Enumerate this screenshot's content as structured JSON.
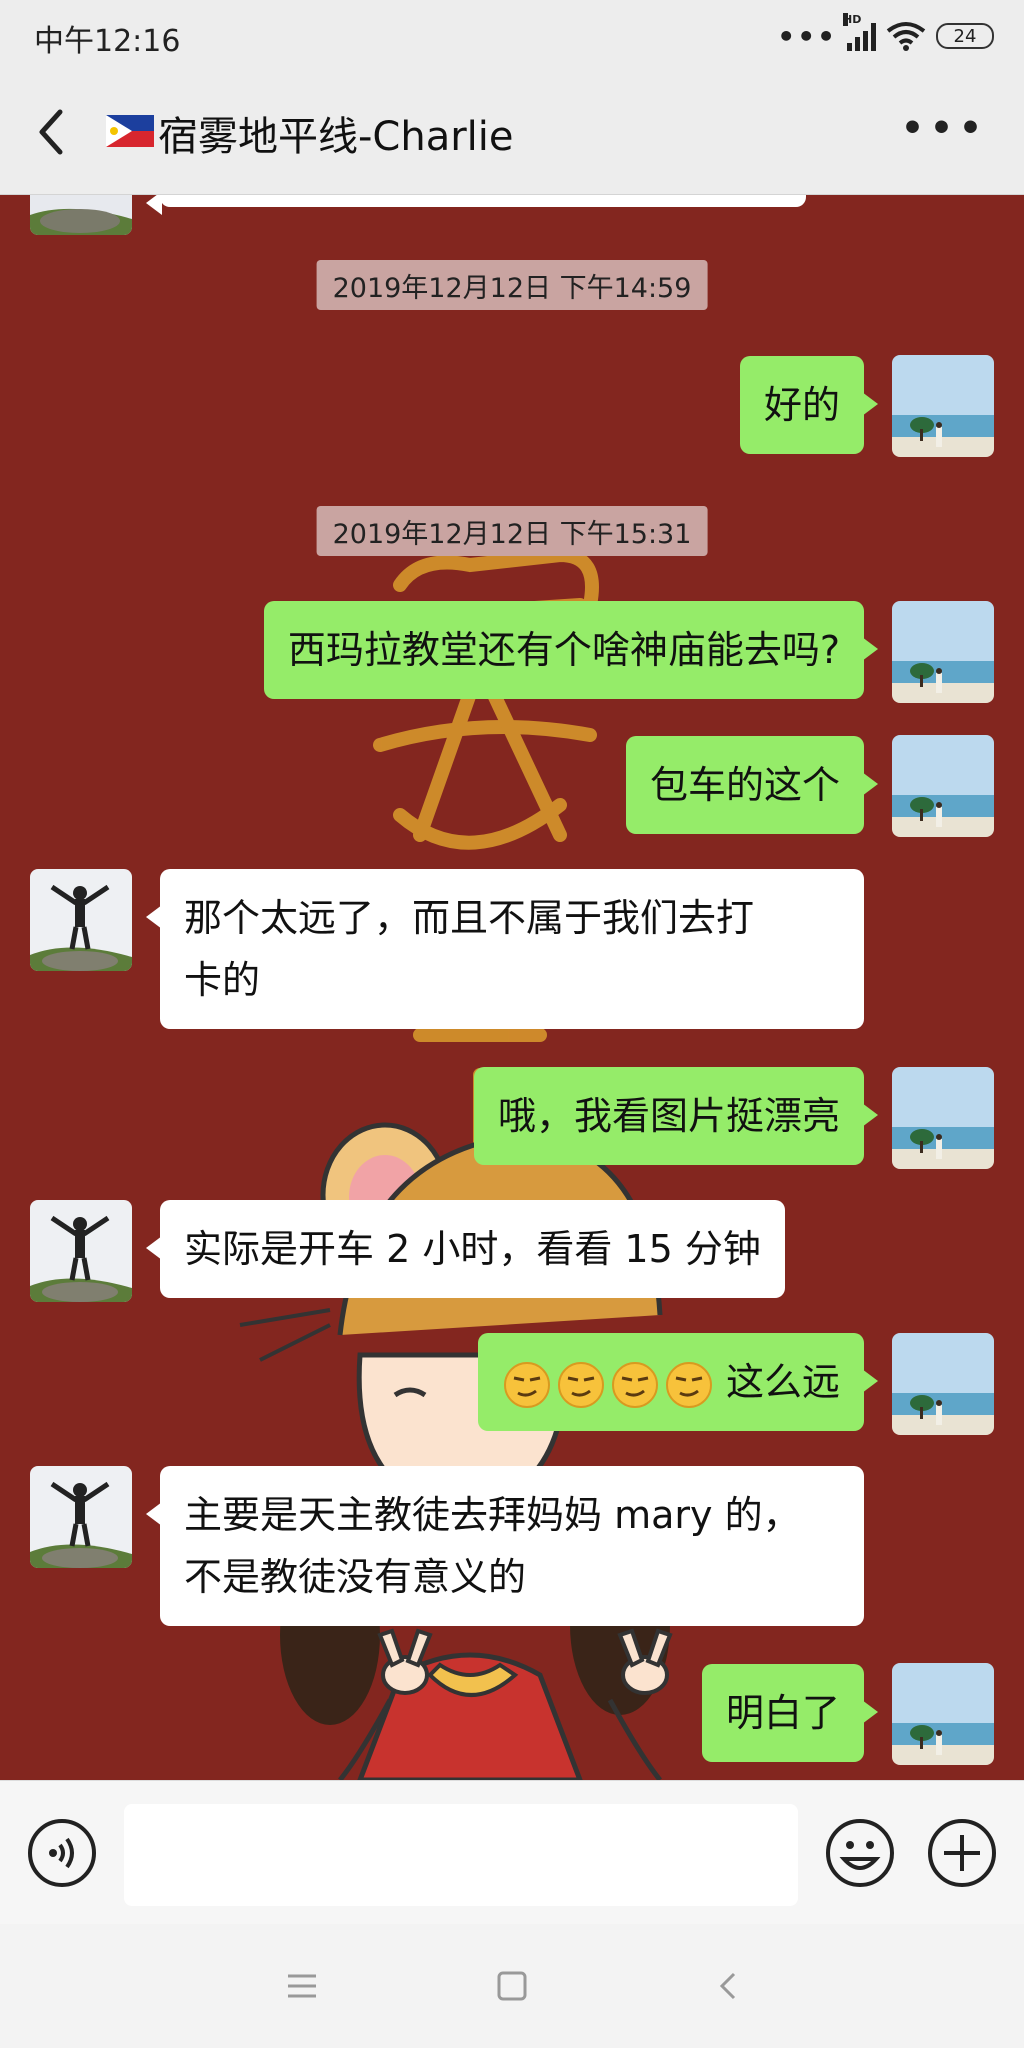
{
  "status": {
    "time": "中午12:16",
    "dots": "•••",
    "network": "HD",
    "battery": "24"
  },
  "header": {
    "title": "宿雾地平线-Charlie",
    "flag": "philippines-flag",
    "back_icon": "chevron-left-icon",
    "more_icon": "more-icon",
    "more_label": "•••"
  },
  "chat": {
    "timestamps": [
      "2019年12月12日 下午14:59",
      "2019年12月12日 下午15:31"
    ],
    "messages": [
      {
        "from": "me",
        "text": "好的"
      },
      {
        "from": "me",
        "text": "西玛拉教堂还有个啥神庙能去吗?"
      },
      {
        "from": "me",
        "text": "包车的这个"
      },
      {
        "from": "them",
        "lines": [
          "那个太远了，而且不属于我们去打",
          "卡的"
        ]
      },
      {
        "from": "me",
        "text": "哦，我看图片挺漂亮"
      },
      {
        "from": "them",
        "text": "实际是开车 2 小时，看看 15 分钟"
      },
      {
        "from": "me",
        "text": "这么远",
        "emoji": "smirk-face-icon",
        "emoji_count": 4
      },
      {
        "from": "them",
        "lines": [
          "主要是天主教徒去拜妈妈 mary 的，",
          "不是教徒没有意义的"
        ]
      },
      {
        "from": "me",
        "text": "明白了"
      }
    ]
  },
  "input": {
    "placeholder": "",
    "value": ""
  },
  "colors": {
    "background": "#83261f",
    "my_bubble": "#95ec69",
    "their_bubble": "#ffffff",
    "timestamp_bg": "#c9a4a1",
    "bar": "#ededed"
  },
  "nav": {
    "icons": [
      "menu-icon",
      "home-square-icon",
      "back-icon"
    ]
  }
}
